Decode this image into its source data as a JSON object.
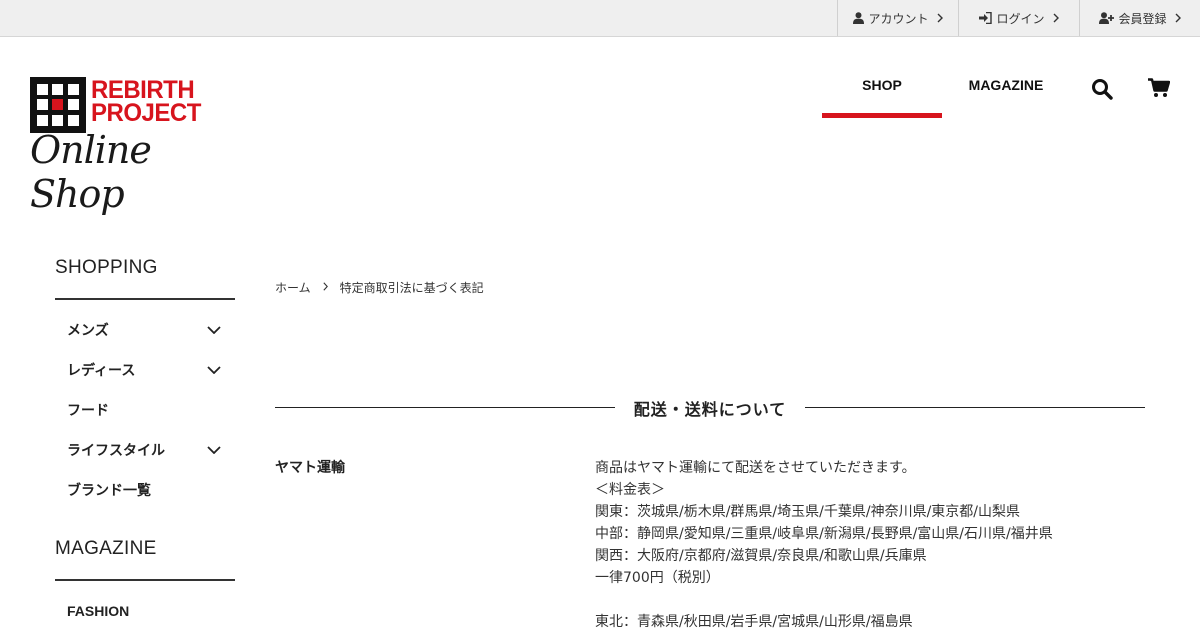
{
  "topbar": {
    "links": [
      {
        "label": "アカウント",
        "icon": "user-icon"
      },
      {
        "label": "ログイン",
        "icon": "login-icon"
      },
      {
        "label": "会員登録",
        "icon": "user-plus-icon"
      }
    ]
  },
  "logo": {
    "name_line1": "REBIRTH",
    "name_line2": "PROJECT",
    "script": "Online Shop",
    "brand_color": "#d7141d"
  },
  "nav": {
    "items": [
      {
        "label": "SHOP",
        "active": true
      },
      {
        "label": "MAGAZINE",
        "active": false
      }
    ],
    "icons": [
      "search-icon",
      "cart-icon"
    ]
  },
  "sidebar": {
    "shopping_heading": "SHOPPING",
    "shopping_items": [
      {
        "label": "メンズ",
        "expandable": true
      },
      {
        "label": "レディース",
        "expandable": true
      },
      {
        "label": "フード",
        "expandable": false
      },
      {
        "label": "ライフスタイル",
        "expandable": true
      },
      {
        "label": "ブランド一覧",
        "expandable": false
      }
    ],
    "magazine_heading": "MAGAZINE",
    "magazine_items": [
      {
        "label": "FASHION"
      }
    ]
  },
  "breadcrumb": {
    "home": "ホーム",
    "current": "特定商取引法に基づく表記"
  },
  "section": {
    "title": "配送・送料について"
  },
  "shipping": {
    "carrier": "ヤマト運輸",
    "lines": [
      "商品はヤマト運輸にて配送をさせていただきます。",
      "＜料金表＞",
      "関東：茨城県/栃木県/群馬県/埼玉県/千葉県/神奈川県/東京都/山梨県",
      "中部：静岡県/愛知県/三重県/岐阜県/新潟県/長野県/富山県/石川県/福井県",
      "関西：大阪府/京都府/滋賀県/奈良県/和歌山県/兵庫県",
      "一律700円（税別）",
      "",
      "東北：青森県/秋田県/岩手県/宮城県/山形県/福島県"
    ]
  }
}
